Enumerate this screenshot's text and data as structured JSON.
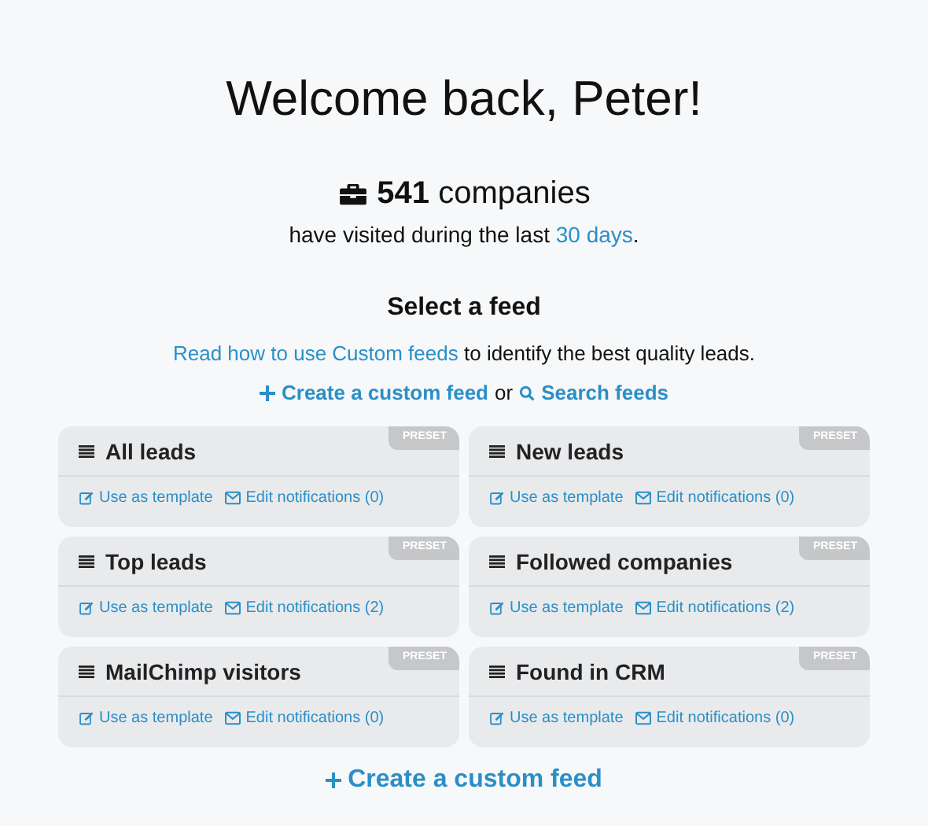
{
  "greeting": "Welcome back, Peter!",
  "stats": {
    "headline": "**541** companies",
    "text_before": "have visited during the last ",
    "link": "30 days",
    "text_after": "."
  },
  "feed_section": {
    "title": "Select a feed",
    "help_link": "Read how to use Custom feeds",
    "help_text": " to identify the best quality leads.",
    "create_link": "Create a custom feed",
    "or": "or",
    "search_link": "Search feeds"
  },
  "feeds": [
    {
      "name": "All leads",
      "badge": "PRESET",
      "template_link": "Use as template",
      "notifications_link": "Edit notifications (0)"
    },
    {
      "name": "New leads",
      "badge": "PRESET",
      "template_link": "Use as template",
      "notifications_link": "Edit notifications (0)"
    },
    {
      "name": "Top leads",
      "badge": "PRESET",
      "template_link": "Use as template",
      "notifications_link": "Edit notifications (2)"
    },
    {
      "name": "Followed companies",
      "badge": "PRESET",
      "template_link": "Use as template",
      "notifications_link": "Edit notifications (2)"
    },
    {
      "name": "MailChimp visitors",
      "badge": "PRESET",
      "template_link": "Use as template",
      "notifications_link": "Edit notifications (0)"
    },
    {
      "name": "Found in CRM",
      "badge": "PRESET",
      "template_link": "Use as template",
      "notifications_link": "Edit notifications (0)"
    }
  ],
  "bottom_link": "Create a custom feed"
}
